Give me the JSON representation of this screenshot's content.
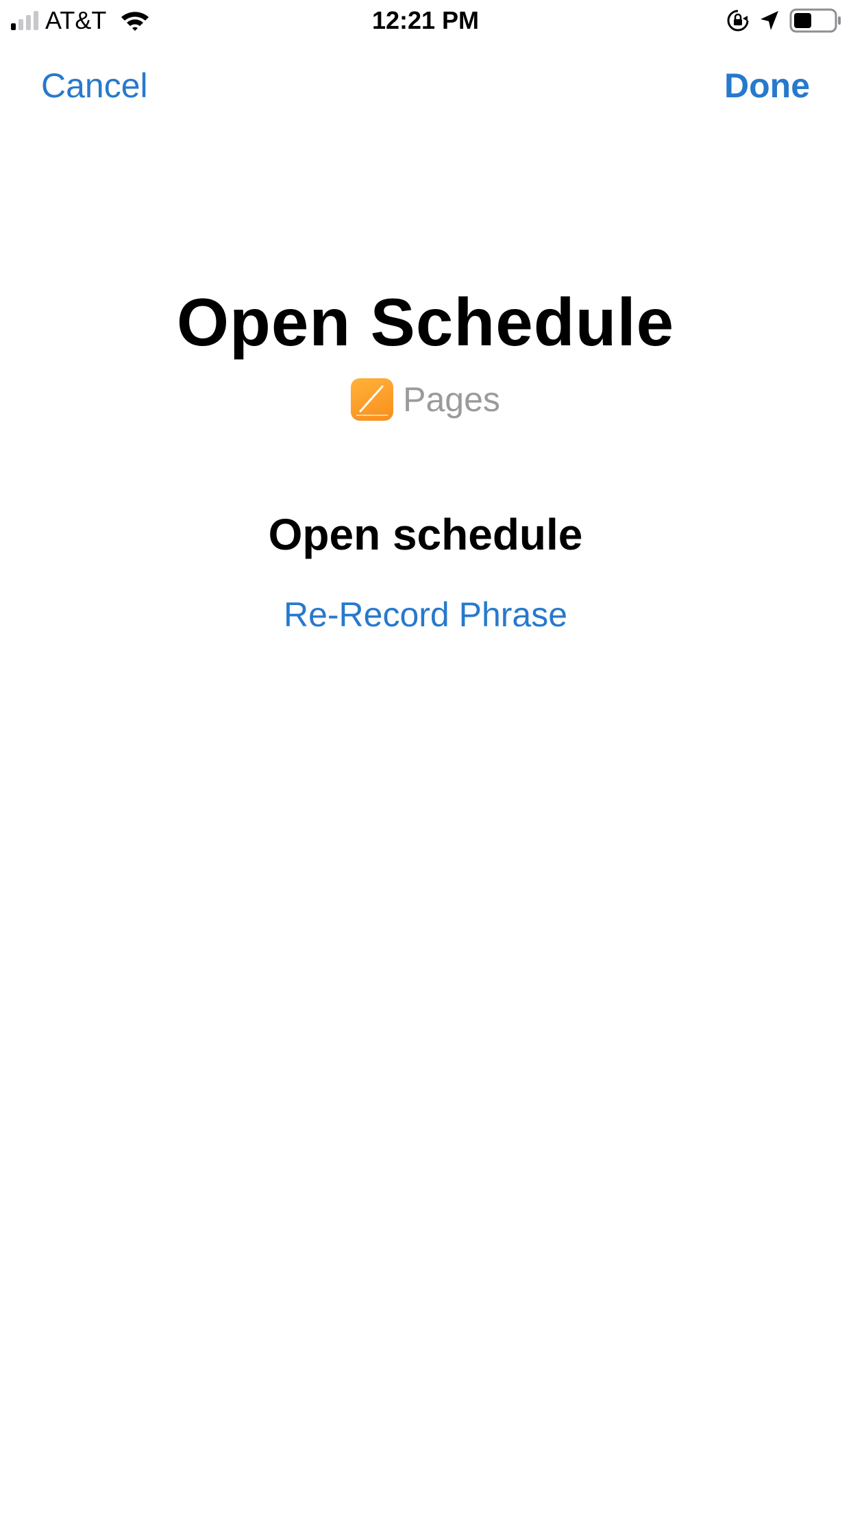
{
  "status_bar": {
    "carrier": "AT&T",
    "time": "12:21 PM",
    "signal_bars_active": 1,
    "signal_bars_total": 4,
    "battery_level": 0.45
  },
  "nav": {
    "cancel_label": "Cancel",
    "done_label": "Done"
  },
  "shortcut": {
    "title": "Open Schedule",
    "app_name": "Pages",
    "phrase": "Open schedule",
    "rerecord_label": "Re-Record Phrase"
  },
  "colors": {
    "accent": "#2779cc",
    "secondary_text": "#9a9a9a",
    "app_icon": "#f98e1c"
  },
  "icons": {
    "signal": "cellular-signal-icon",
    "wifi": "wifi-icon",
    "rotation_lock": "rotation-lock-icon",
    "location": "location-arrow-icon",
    "battery": "battery-icon",
    "app": "pages-app-icon"
  }
}
